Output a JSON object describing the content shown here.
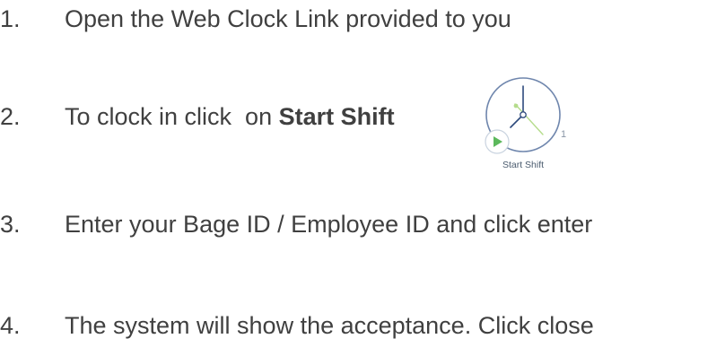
{
  "steps": [
    {
      "number": "1.",
      "text": "Open the Web Clock Link provided to you"
    },
    {
      "number": "2.",
      "text_prefix": "To clock in click  on ",
      "text_bold": "Start Shift"
    },
    {
      "number": "3.",
      "text": "Enter your Bage ID / Employee ID and click enter"
    },
    {
      "number": "4.",
      "text": "The system will show the acceptance. Click close"
    }
  ],
  "start_shift_widget": {
    "label": "Start Shift",
    "clock_numeral": "1",
    "icons": {
      "clock": "clock-icon",
      "play": "play-icon"
    },
    "colors": {
      "clock_ring": "#6f86ad",
      "hands": "#2e4a7d",
      "second_hand": "#b5dc8c",
      "play_triangle": "#5cb85c",
      "play_circle_border": "#c9d3df",
      "label": "#4a5b6e"
    }
  },
  "colors": {
    "text": "#404040",
    "background": "#ffffff"
  }
}
